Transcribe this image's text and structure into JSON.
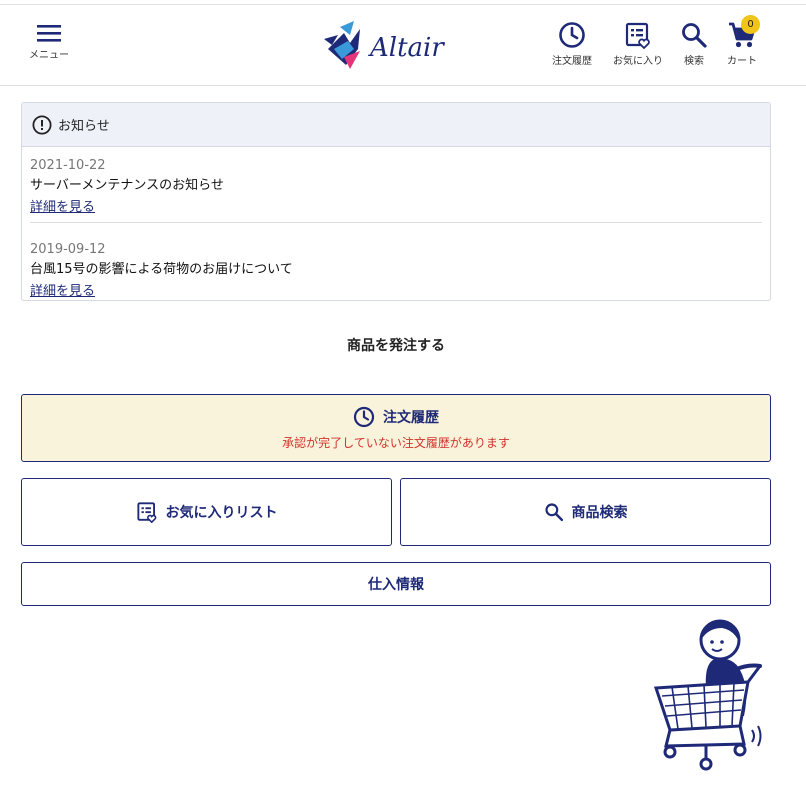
{
  "header": {
    "menu_label": "メニュー",
    "logo_text": "Altair",
    "history_label": "注文履歴",
    "favorites_label": "お気に入り",
    "search_label": "検索",
    "cart_label": "カート",
    "cart_count": "0"
  },
  "notice": {
    "title": "お知らせ",
    "items": [
      {
        "date": "2021-10-22",
        "title": "サーバーメンテナンスのお知らせ",
        "link": "詳細を見る"
      },
      {
        "date": "2019-09-12",
        "title": "台風15号の影響による荷物のお届けについて",
        "link": "詳細を見る"
      }
    ]
  },
  "main": {
    "section_title": "商品を発注する",
    "order_history": {
      "label": "注文履歴",
      "warning": "承認が完了していない注文履歴があります"
    },
    "favorites_list_label": "お気に入りリスト",
    "product_search_label": "商品検索",
    "purchase_info_label": "仕入情報"
  },
  "colors": {
    "brand_navy": "#1e2a78",
    "notice_header_bg": "#eef1f8",
    "order_box_bg": "#faf3dc",
    "warning_red": "#d0342c",
    "badge_yellow": "#f0c419"
  },
  "icons": [
    "hamburger-icon",
    "clock-icon",
    "favorite-list-icon",
    "search-icon",
    "cart-icon",
    "alert-circle-icon"
  ]
}
